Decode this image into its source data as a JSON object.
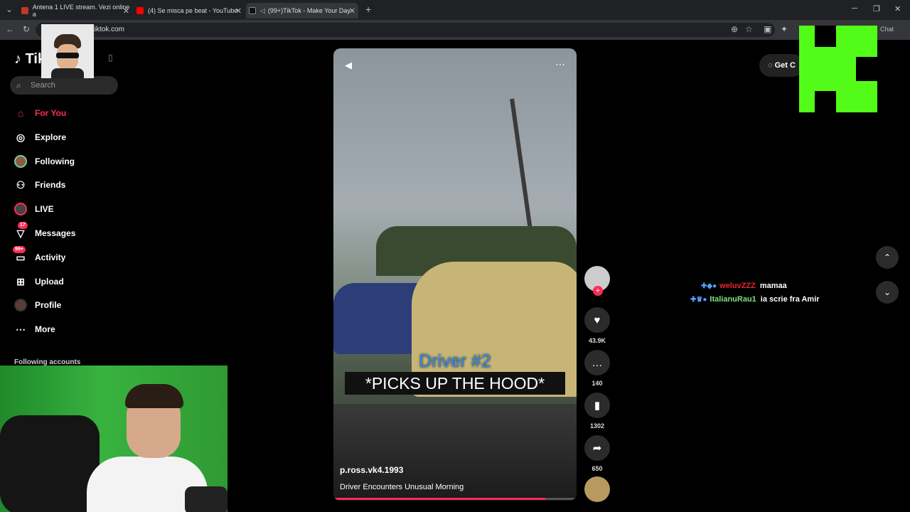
{
  "browser": {
    "tabs": [
      {
        "title": "Antena 1 LIVE stream. Vezi online a",
        "favicon_color": "#c0392b"
      },
      {
        "title": "(4) Se misca pe beat - YouTube",
        "favicon_color": "#ff0000"
      },
      {
        "title": "(99+)TikTok - Make Your Day",
        "favicon_color": "#111111"
      }
    ],
    "new_tab": "+",
    "url": "tiktok.com",
    "chat_label": "Chat"
  },
  "sidebar": {
    "logo": "TikTok",
    "search_placeholder": "Search",
    "items": [
      {
        "label": "For You",
        "icon": "home-icon",
        "glyph": "⌂",
        "active": true
      },
      {
        "label": "Explore",
        "icon": "compass-icon",
        "glyph": "◎"
      },
      {
        "label": "Following",
        "icon": "following-avatar-icon",
        "glyph": ""
      },
      {
        "label": "Friends",
        "icon": "friends-icon",
        "glyph": "⚇"
      },
      {
        "label": "LIVE",
        "icon": "live-icon",
        "glyph": ""
      },
      {
        "label": "Messages",
        "icon": "send-icon",
        "glyph": "▽",
        "badge": "17"
      },
      {
        "label": "Activity",
        "icon": "inbox-icon",
        "glyph": "▭",
        "badge": "99+"
      },
      {
        "label": "Upload",
        "icon": "upload-icon",
        "glyph": "⊞"
      },
      {
        "label": "Profile",
        "icon": "profile-icon",
        "glyph": ""
      },
      {
        "label": "More",
        "icon": "more-icon",
        "glyph": "⋯"
      }
    ],
    "following_accounts": "Following accounts"
  },
  "video": {
    "caption_line1": "Driver #2",
    "caption_line2": "*PICKS UP THE HOOD*",
    "username": "p.ross.vk4.1993",
    "description": "Driver Encounters Unusual Morning",
    "progress": 0.87
  },
  "actions": {
    "likes": "43.9K",
    "comments": "140",
    "saves": "1302",
    "shares": "650"
  },
  "topright": {
    "get_coins": "Get C"
  },
  "chat": [
    {
      "user": "weluvZZZ",
      "message": "mamaa"
    },
    {
      "user": "ItalianuRau1",
      "message": "ia scrie fra Amir"
    }
  ],
  "colors": {
    "accent": "#fe2c55",
    "kick_green": "#53fc18"
  }
}
